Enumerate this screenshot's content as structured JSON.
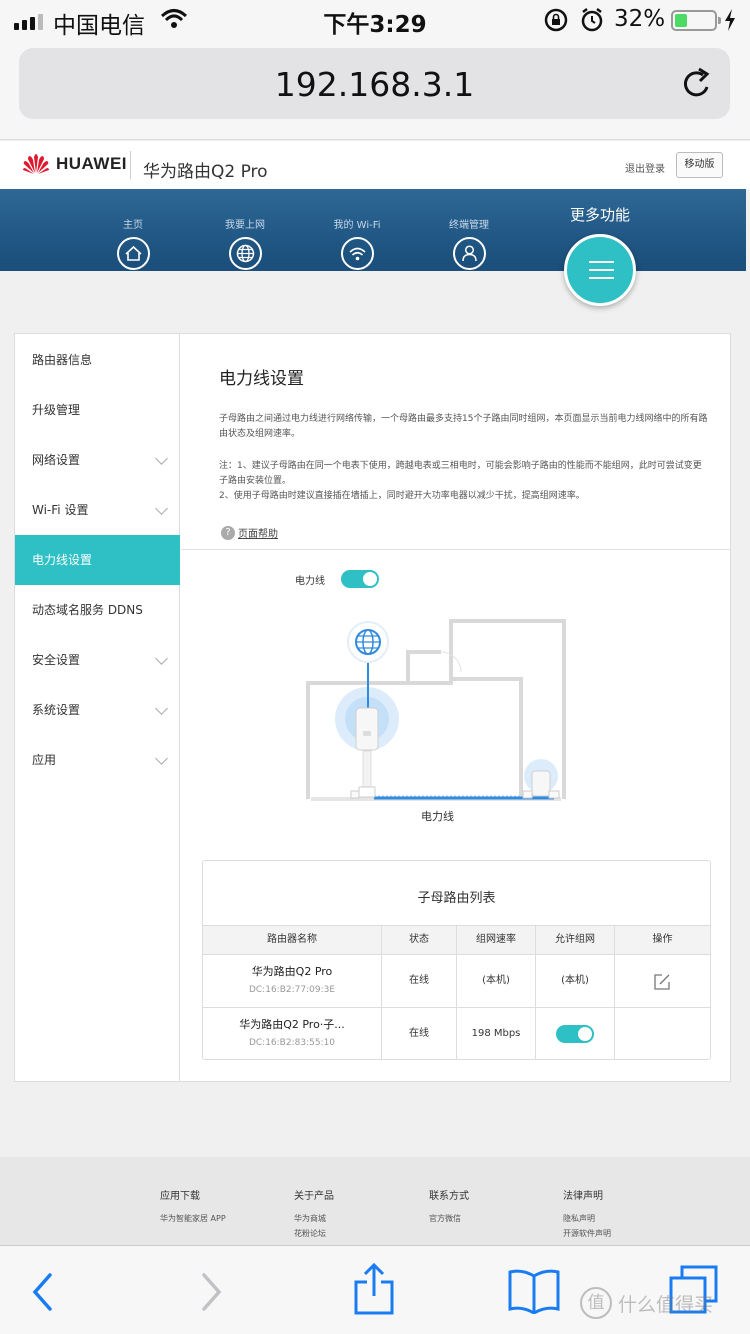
{
  "status_bar": {
    "carrier": "中国电信",
    "time": "下午3:29",
    "battery_percent": "32%",
    "battery_level": 0.32
  },
  "browser": {
    "url": "192.168.3.1"
  },
  "header": {
    "brand": "HUAWEI",
    "product": "华为路由Q2 Pro",
    "logout": "退出登录",
    "mobile_version": "移动版"
  },
  "nav": {
    "items": [
      {
        "label": "主页",
        "icon": "home-icon"
      },
      {
        "label": "我要上网",
        "icon": "globe-icon"
      },
      {
        "label": "我的 Wi-Fi",
        "icon": "wifi-icon"
      },
      {
        "label": "终端管理",
        "icon": "user-icon"
      }
    ],
    "more_label": "更多功能",
    "accent": "#2ec0c4",
    "bar_color": "#215784"
  },
  "sidebar": {
    "items": [
      {
        "label": "路由器信息",
        "active": false,
        "expandable": false
      },
      {
        "label": "升级管理",
        "active": false,
        "expandable": false
      },
      {
        "label": "网络设置",
        "active": false,
        "expandable": true
      },
      {
        "label": "Wi-Fi 设置",
        "active": false,
        "expandable": true
      },
      {
        "label": "电力线设置",
        "active": true,
        "expandable": false
      },
      {
        "label": "动态域名服务 DDNS",
        "active": false,
        "expandable": false
      },
      {
        "label": "安全设置",
        "active": false,
        "expandable": true
      },
      {
        "label": "系统设置",
        "active": false,
        "expandable": true
      },
      {
        "label": "应用",
        "active": false,
        "expandable": true
      }
    ]
  },
  "main": {
    "title": "电力线设置",
    "description": "子母路由之间通过电力线进行网络传输，一个母路由最多支持15个子路由同时组网，本页面显示当前电力线网络中的所有路由状态及组网速率。",
    "note_1": "注：1、建议子母路由在同一个电表下使用，跨越电表或三相电时，可能会影响子路由的性能而不能组网，此时可尝试变更子路由安装位置。",
    "note_2": "2、使用子母路由时建议直接插在墙插上，同时避开大功率电器以减少干扰，提高组网速率。",
    "help": "页面帮助",
    "plc_toggle_label": "电力线",
    "plc_enabled": true,
    "diagram_label": "电力线"
  },
  "router_table": {
    "title": "子母路由列表",
    "headers": [
      "路由器名称",
      "状态",
      "组网速率",
      "允许组网",
      "操作"
    ],
    "rows": [
      {
        "name": "华为路由Q2 Pro",
        "mac": "DC:16:B2:77:09:3E",
        "status": "在线",
        "rate": "(本机)",
        "allow": "(本机)",
        "editable": true
      },
      {
        "name": "华为路由Q2 Pro·子...",
        "mac": "DC:16:B2:83:55:10",
        "status": "在线",
        "rate": "198 Mbps",
        "allow_toggle": true,
        "editable": false
      }
    ]
  },
  "footer": {
    "columns": [
      {
        "heading": "应用下载",
        "links": [
          "华为智能家居 APP"
        ]
      },
      {
        "heading": "关于产品",
        "links": [
          "华为商城",
          "花粉论坛"
        ]
      },
      {
        "heading": "联系方式",
        "links": [
          "官方微信"
        ]
      },
      {
        "heading": "法律声明",
        "links": [
          "隐私声明",
          "开源软件声明"
        ]
      }
    ]
  },
  "toolbar": {
    "icons": [
      "back-icon",
      "forward-icon",
      "share-icon",
      "bookmarks-icon",
      "tabs-icon"
    ]
  },
  "watermark": {
    "mark": "值",
    "text": "什么值得买"
  }
}
